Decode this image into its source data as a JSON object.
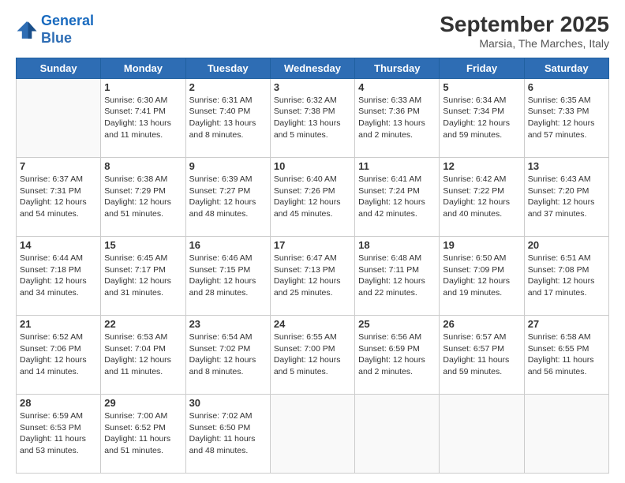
{
  "logo": {
    "line1": "General",
    "line2": "Blue"
  },
  "header": {
    "month": "September 2025",
    "location": "Marsia, The Marches, Italy"
  },
  "weekdays": [
    "Sunday",
    "Monday",
    "Tuesday",
    "Wednesday",
    "Thursday",
    "Friday",
    "Saturday"
  ],
  "weeks": [
    [
      {
        "day": "",
        "sunrise": "",
        "sunset": "",
        "daylight": ""
      },
      {
        "day": "1",
        "sunrise": "Sunrise: 6:30 AM",
        "sunset": "Sunset: 7:41 PM",
        "daylight": "Daylight: 13 hours and 11 minutes."
      },
      {
        "day": "2",
        "sunrise": "Sunrise: 6:31 AM",
        "sunset": "Sunset: 7:40 PM",
        "daylight": "Daylight: 13 hours and 8 minutes."
      },
      {
        "day": "3",
        "sunrise": "Sunrise: 6:32 AM",
        "sunset": "Sunset: 7:38 PM",
        "daylight": "Daylight: 13 hours and 5 minutes."
      },
      {
        "day": "4",
        "sunrise": "Sunrise: 6:33 AM",
        "sunset": "Sunset: 7:36 PM",
        "daylight": "Daylight: 13 hours and 2 minutes."
      },
      {
        "day": "5",
        "sunrise": "Sunrise: 6:34 AM",
        "sunset": "Sunset: 7:34 PM",
        "daylight": "Daylight: 12 hours and 59 minutes."
      },
      {
        "day": "6",
        "sunrise": "Sunrise: 6:35 AM",
        "sunset": "Sunset: 7:33 PM",
        "daylight": "Daylight: 12 hours and 57 minutes."
      }
    ],
    [
      {
        "day": "7",
        "sunrise": "Sunrise: 6:37 AM",
        "sunset": "Sunset: 7:31 PM",
        "daylight": "Daylight: 12 hours and 54 minutes."
      },
      {
        "day": "8",
        "sunrise": "Sunrise: 6:38 AM",
        "sunset": "Sunset: 7:29 PM",
        "daylight": "Daylight: 12 hours and 51 minutes."
      },
      {
        "day": "9",
        "sunrise": "Sunrise: 6:39 AM",
        "sunset": "Sunset: 7:27 PM",
        "daylight": "Daylight: 12 hours and 48 minutes."
      },
      {
        "day": "10",
        "sunrise": "Sunrise: 6:40 AM",
        "sunset": "Sunset: 7:26 PM",
        "daylight": "Daylight: 12 hours and 45 minutes."
      },
      {
        "day": "11",
        "sunrise": "Sunrise: 6:41 AM",
        "sunset": "Sunset: 7:24 PM",
        "daylight": "Daylight: 12 hours and 42 minutes."
      },
      {
        "day": "12",
        "sunrise": "Sunrise: 6:42 AM",
        "sunset": "Sunset: 7:22 PM",
        "daylight": "Daylight: 12 hours and 40 minutes."
      },
      {
        "day": "13",
        "sunrise": "Sunrise: 6:43 AM",
        "sunset": "Sunset: 7:20 PM",
        "daylight": "Daylight: 12 hours and 37 minutes."
      }
    ],
    [
      {
        "day": "14",
        "sunrise": "Sunrise: 6:44 AM",
        "sunset": "Sunset: 7:18 PM",
        "daylight": "Daylight: 12 hours and 34 minutes."
      },
      {
        "day": "15",
        "sunrise": "Sunrise: 6:45 AM",
        "sunset": "Sunset: 7:17 PM",
        "daylight": "Daylight: 12 hours and 31 minutes."
      },
      {
        "day": "16",
        "sunrise": "Sunrise: 6:46 AM",
        "sunset": "Sunset: 7:15 PM",
        "daylight": "Daylight: 12 hours and 28 minutes."
      },
      {
        "day": "17",
        "sunrise": "Sunrise: 6:47 AM",
        "sunset": "Sunset: 7:13 PM",
        "daylight": "Daylight: 12 hours and 25 minutes."
      },
      {
        "day": "18",
        "sunrise": "Sunrise: 6:48 AM",
        "sunset": "Sunset: 7:11 PM",
        "daylight": "Daylight: 12 hours and 22 minutes."
      },
      {
        "day": "19",
        "sunrise": "Sunrise: 6:50 AM",
        "sunset": "Sunset: 7:09 PM",
        "daylight": "Daylight: 12 hours and 19 minutes."
      },
      {
        "day": "20",
        "sunrise": "Sunrise: 6:51 AM",
        "sunset": "Sunset: 7:08 PM",
        "daylight": "Daylight: 12 hours and 17 minutes."
      }
    ],
    [
      {
        "day": "21",
        "sunrise": "Sunrise: 6:52 AM",
        "sunset": "Sunset: 7:06 PM",
        "daylight": "Daylight: 12 hours and 14 minutes."
      },
      {
        "day": "22",
        "sunrise": "Sunrise: 6:53 AM",
        "sunset": "Sunset: 7:04 PM",
        "daylight": "Daylight: 12 hours and 11 minutes."
      },
      {
        "day": "23",
        "sunrise": "Sunrise: 6:54 AM",
        "sunset": "Sunset: 7:02 PM",
        "daylight": "Daylight: 12 hours and 8 minutes."
      },
      {
        "day": "24",
        "sunrise": "Sunrise: 6:55 AM",
        "sunset": "Sunset: 7:00 PM",
        "daylight": "Daylight: 12 hours and 5 minutes."
      },
      {
        "day": "25",
        "sunrise": "Sunrise: 6:56 AM",
        "sunset": "Sunset: 6:59 PM",
        "daylight": "Daylight: 12 hours and 2 minutes."
      },
      {
        "day": "26",
        "sunrise": "Sunrise: 6:57 AM",
        "sunset": "Sunset: 6:57 PM",
        "daylight": "Daylight: 11 hours and 59 minutes."
      },
      {
        "day": "27",
        "sunrise": "Sunrise: 6:58 AM",
        "sunset": "Sunset: 6:55 PM",
        "daylight": "Daylight: 11 hours and 56 minutes."
      }
    ],
    [
      {
        "day": "28",
        "sunrise": "Sunrise: 6:59 AM",
        "sunset": "Sunset: 6:53 PM",
        "daylight": "Daylight: 11 hours and 53 minutes."
      },
      {
        "day": "29",
        "sunrise": "Sunrise: 7:00 AM",
        "sunset": "Sunset: 6:52 PM",
        "daylight": "Daylight: 11 hours and 51 minutes."
      },
      {
        "day": "30",
        "sunrise": "Sunrise: 7:02 AM",
        "sunset": "Sunset: 6:50 PM",
        "daylight": "Daylight: 11 hours and 48 minutes."
      },
      {
        "day": "",
        "sunrise": "",
        "sunset": "",
        "daylight": ""
      },
      {
        "day": "",
        "sunrise": "",
        "sunset": "",
        "daylight": ""
      },
      {
        "day": "",
        "sunrise": "",
        "sunset": "",
        "daylight": ""
      },
      {
        "day": "",
        "sunrise": "",
        "sunset": "",
        "daylight": ""
      }
    ]
  ]
}
